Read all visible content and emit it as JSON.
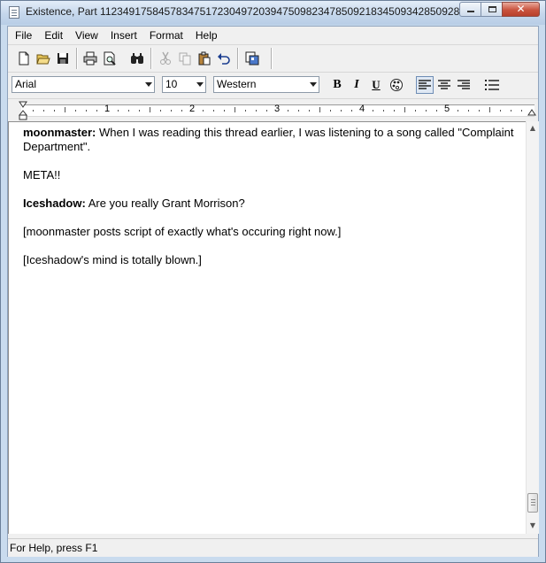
{
  "window": {
    "title": "Existence, Part 11234917584578347517230497203947509823478509218345093428509​28...",
    "controls": {
      "minimize": "minimize",
      "maximize": "maximize",
      "close": "✕"
    }
  },
  "menu": [
    "File",
    "Edit",
    "View",
    "Insert",
    "Format",
    "Help"
  ],
  "toolbar": {
    "icons": [
      "new-icon",
      "open-icon",
      "save-icon",
      "print-icon",
      "print-preview-icon",
      "find-icon",
      "cut-icon",
      "copy-icon",
      "paste-icon",
      "undo-icon",
      "insert-object-icon"
    ]
  },
  "format": {
    "font": "Arial",
    "size": "10",
    "script": "Western",
    "bold": "B",
    "italic": "I",
    "underline": "U",
    "alignment": "left"
  },
  "ruler": {
    "numbers": [
      "1",
      "2",
      "3",
      "4",
      "5"
    ]
  },
  "document": {
    "paragraphs": [
      {
        "speaker": "moonmaster:",
        "text": " When I was reading this thread earlier, I was listening to a song called \"Complaint Department\"."
      },
      {
        "speaker": "",
        "text": "META!!"
      },
      {
        "speaker": "Iceshadow:",
        "text": " Are you really Grant Morrison?"
      },
      {
        "speaker": "",
        "text": "[moonmaster posts script of exactly what's occuring right now.]"
      },
      {
        "speaker": "",
        "text": "[Iceshadow's mind is totally blown.]"
      }
    ]
  },
  "status": "For Help, press F1"
}
